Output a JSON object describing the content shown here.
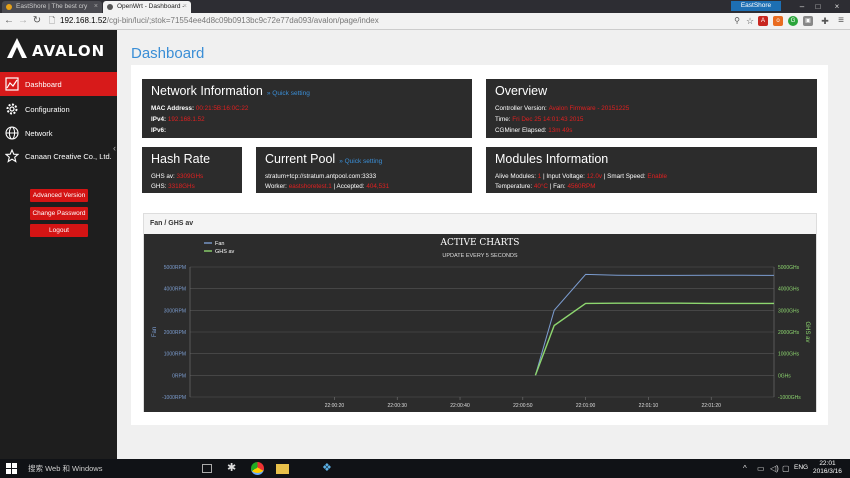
{
  "browser": {
    "tabs": [
      {
        "label": "EastShore | The best cry",
        "active": false
      },
      {
        "label": "OpenWrt - Dashboard -",
        "active": true
      }
    ],
    "profile_name": "EastShore",
    "url_host": "192.168.1.52",
    "url_path": "/cgi-bin/luci/;stok=71554ee4d8c09b0913bc9c72e77da093/avalon/page/index"
  },
  "sidebar": {
    "brand": "AVALON",
    "items": [
      {
        "label": "Dashboard",
        "icon": "chart-icon",
        "active": true
      },
      {
        "label": "Configuration",
        "icon": "gear-icon",
        "active": false
      },
      {
        "label": "Network",
        "icon": "globe-icon",
        "active": false
      },
      {
        "label": "Canaan Creative Co., Ltd.",
        "icon": "star-icon",
        "active": false
      }
    ],
    "buttons": {
      "advanced": "Advanced Version",
      "change_password": "Change Password",
      "logout": "Logout"
    }
  },
  "page_title": "Dashboard",
  "network": {
    "title": "Network Information",
    "quick": "» Quick setting",
    "mac_label": "MAC Address:",
    "mac_value": "00:21:5B:16:0C:22",
    "ipv4_label": "IPv4:",
    "ipv4_value": "192.168.1.52",
    "ipv6_label": "IPv6:",
    "ipv6_value": ""
  },
  "overview": {
    "title": "Overview",
    "controller_label": "Controller Version:",
    "controller_value": "Avalon Firmware - 20151225",
    "time_label": "Time:",
    "time_value": "Fri Dec 25 14:01:43 2015",
    "elapsed_label": "CGMiner Elapsed:",
    "elapsed_value": "13m 49s"
  },
  "hashrate": {
    "title": "Hash Rate",
    "ghsav_label": "GHS av:",
    "ghsav_value": "3309GHs",
    "ghs_label": "GHS:",
    "ghs_value": "3318GHs"
  },
  "pool": {
    "title": "Current Pool",
    "quick": "» Quick setting",
    "url": "stratum+tcp://stratum.antpool.com:3333",
    "worker_label": "Worker:",
    "worker_value": "eastshoretest.1",
    "sep": " | ",
    "accepted_label": "Accepted:",
    "accepted_value": "404,531"
  },
  "modules": {
    "title": "Modules Information",
    "alive_label": "Alive Modules:",
    "alive_value": "1",
    "voltage_label": "| Input Voltage:",
    "voltage_value": "12.0v",
    "speed_label": "| Smart Speed:",
    "speed_value": "Enable",
    "temp_label": "Temperature:",
    "temp_value": "40°C",
    "fan_label": "| Fan:",
    "fan_value": "4560RPM"
  },
  "chart_box_title": "Fan / GHS av",
  "chart_data": {
    "type": "line",
    "title": "ACTIVE CHARTS",
    "subtitle": "UPDATE EVERY 5 SECONDS",
    "x": [
      "21:59:57",
      "22:00:00",
      "22:00:05",
      "22:00:10",
      "22:00:15",
      "22:00:20",
      "22:00:25",
      "22:00:30",
      "22:00:35",
      "22:00:40",
      "22:00:45",
      "22:00:50",
      "22:00:52",
      "22:00:55",
      "22:01:00",
      "22:01:05",
      "22:01:10",
      "22:01:15",
      "22:01:20",
      "22:01:25",
      "22:01:30"
    ],
    "xticks": [
      "22:00:20",
      "22:00:30",
      "22:00:40",
      "22:00:50",
      "22:01:00",
      "22:01:10",
      "22:01:20"
    ],
    "series": [
      {
        "name": "Fan",
        "axis": "left",
        "color": "#7b9ccf",
        "values": [
          null,
          null,
          null,
          null,
          null,
          null,
          null,
          null,
          null,
          null,
          null,
          null,
          0,
          3000,
          4660,
          4620,
          4610,
          4610,
          4620,
          4620,
          4610
        ]
      },
      {
        "name": "GHS av",
        "axis": "right",
        "color": "#8dd66f",
        "values": [
          null,
          null,
          null,
          null,
          null,
          null,
          null,
          null,
          null,
          null,
          null,
          null,
          0,
          2300,
          3320,
          3330,
          3330,
          3330,
          3320,
          3320,
          3320
        ]
      }
    ],
    "ylabel": "Fan",
    "y2label": "GHS av",
    "ylim": [
      -1000,
      5000
    ],
    "y2lim": [
      -1000,
      5000
    ],
    "yticks": [
      "-1000RPM",
      "0RPM",
      "1000RPM",
      "2000RPM",
      "3000RPM",
      "4000RPM",
      "5000RPM"
    ],
    "y2ticks": [
      "-1000GHs",
      "0GHs",
      "1000GHs",
      "2000GHs",
      "3000GHs",
      "4000GHs",
      "5000GHs"
    ],
    "grid": true,
    "legend": "top-left"
  },
  "taskbar": {
    "search": "搜索 Web 和 Windows",
    "lang": "ENG",
    "time": "22:01",
    "date": "2016/3/16"
  },
  "colors": {
    "accent_red": "#d71a1a",
    "link_blue": "#3a8ed6",
    "panel_dark": "#2c2c2c"
  }
}
